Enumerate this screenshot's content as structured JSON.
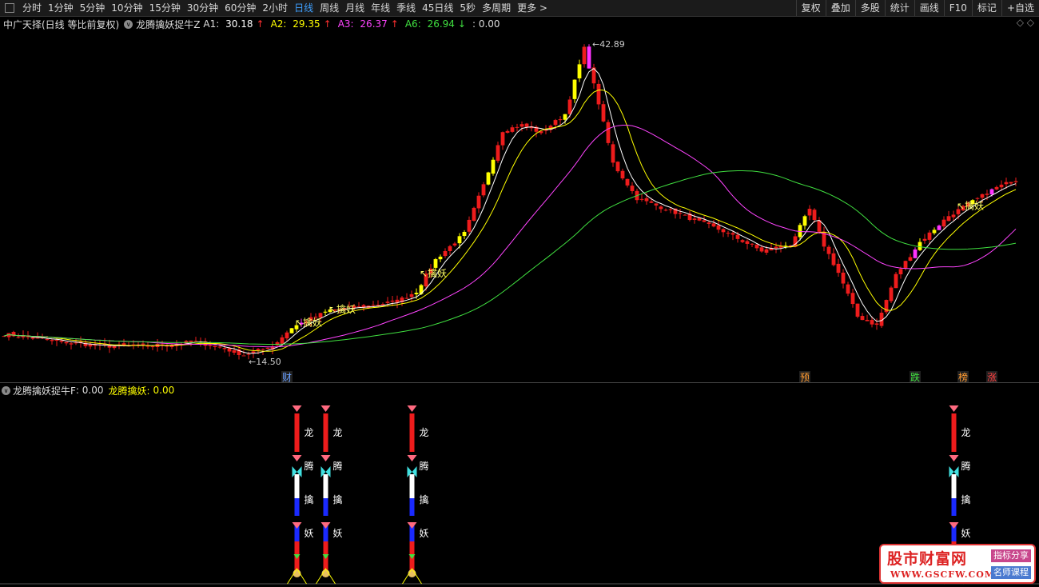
{
  "toolbar": {
    "periods": [
      "分时",
      "1分钟",
      "5分钟",
      "10分钟",
      "15分钟",
      "30分钟",
      "60分钟",
      "2小时",
      "日线",
      "周线",
      "月线",
      "年线",
      "季线",
      "45日线",
      "5秒",
      "多周期",
      "更多 >"
    ],
    "active_index": 8,
    "right_buttons": [
      "复权",
      "叠加",
      "多股",
      "统计",
      "画线",
      "F10",
      "标记",
      "+自选"
    ]
  },
  "info": {
    "stock": "中广天择(日线 等比前复权)",
    "indicator": "龙腾擒妖捉牛Z",
    "A1": {
      "label": "A1:",
      "value": "30.18",
      "arrow": "↑",
      "color": "#ffffff",
      "arrow_color": "#ff3030"
    },
    "A2": {
      "label": "A2:",
      "value": "29.35",
      "arrow": "↑",
      "color": "#ffff00",
      "arrow_color": "#ff3030"
    },
    "A3": {
      "label": "A3:",
      "value": "26.37",
      "arrow": "↑",
      "color": "#ff44ff",
      "arrow_color": "#ff3030"
    },
    "A6": {
      "label": "A6:",
      "value": "26.94",
      "arrow": "↓",
      "color": "#40e040",
      "arrow_color": "#40e040"
    },
    "extra": ": 0.00",
    "right_icons": "◇ ◇"
  },
  "chart_data": {
    "type": "candlestick",
    "price_axis": [
      12,
      44
    ],
    "high_label": "42.89",
    "low_label": "14.50",
    "event_markers": [
      {
        "label": "财",
        "color": "#6aa0ff",
        "candle": 59
      },
      {
        "label": "预",
        "color": "#ff9a30",
        "candle": 167
      },
      {
        "label": "跌",
        "color": "#40e040",
        "candle": 190
      },
      {
        "label": "榜",
        "color": "#ff9a30",
        "candle": 200
      },
      {
        "label": "涨",
        "color": "#ff4040",
        "candle": 206
      }
    ],
    "signal_labels": [
      {
        "text": "擒妖",
        "candle": 62
      },
      {
        "text": "擒妖",
        "candle": 69
      },
      {
        "text": "擒妖",
        "candle": 88
      },
      {
        "text": "擒妖",
        "candle": 200
      }
    ],
    "anchors": [
      [
        0,
        16.4
      ],
      [
        10,
        15.8
      ],
      [
        20,
        15.3
      ],
      [
        30,
        15.3
      ],
      [
        40,
        15.7
      ],
      [
        45,
        15.2
      ],
      [
        50,
        14.5
      ],
      [
        56,
        15.3
      ],
      [
        60,
        17.0
      ],
      [
        68,
        18.6
      ],
      [
        75,
        18.9
      ],
      [
        82,
        19.4
      ],
      [
        86,
        20.3
      ],
      [
        90,
        23.2
      ],
      [
        96,
        25.6
      ],
      [
        100,
        30.0
      ],
      [
        104,
        35.0
      ],
      [
        108,
        35.5
      ],
      [
        112,
        34.8
      ],
      [
        117,
        36.5
      ],
      [
        121,
        42.5
      ],
      [
        124,
        37.5
      ],
      [
        127,
        32.0
      ],
      [
        132,
        28.8
      ],
      [
        140,
        27.5
      ],
      [
        150,
        25.8
      ],
      [
        158,
        24.0
      ],
      [
        164,
        24.6
      ],
      [
        168,
        27.8
      ],
      [
        171,
        24.5
      ],
      [
        174,
        22.0
      ],
      [
        178,
        18.0
      ],
      [
        182,
        17.2
      ],
      [
        186,
        21.8
      ],
      [
        191,
        24.8
      ],
      [
        197,
        27.2
      ],
      [
        202,
        28.5
      ],
      [
        207,
        29.8
      ],
      [
        211,
        30.5
      ]
    ]
  },
  "sub_panel": {
    "title": "龙腾擒妖捉牛F",
    "value_text": ": 0.00",
    "series_label": "龙腾擒妖:",
    "series_value": "0.00",
    "signal_chars": [
      "龙",
      "腾",
      "擒",
      "妖"
    ],
    "signal_candles": [
      61,
      67,
      85,
      198
    ]
  },
  "watermark": {
    "name": "股市财富网",
    "url": "WWW.GSCFW.COM",
    "tag1": "指标分享",
    "tag2": "名师课程"
  }
}
